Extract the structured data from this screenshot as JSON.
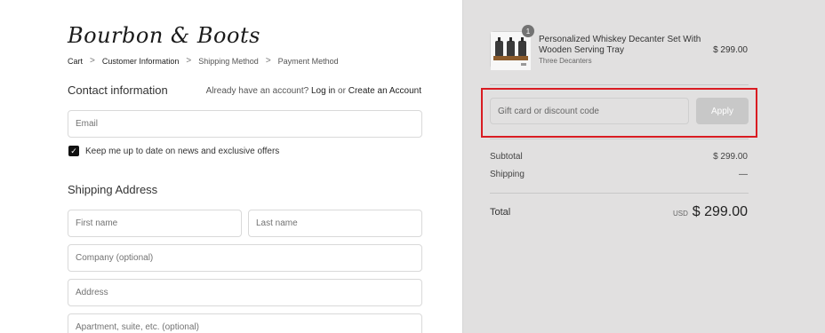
{
  "brand": {
    "logo_text": "Bourbon & Boots"
  },
  "breadcrumb": {
    "items": [
      "Cart",
      "Customer Information",
      "Shipping Method",
      "Payment Method"
    ],
    "separator": ">"
  },
  "contact": {
    "title": "Contact information",
    "account_prompt": "Already have an account?",
    "login_link": "Log in",
    "or_text": "or",
    "create_link": "Create an Account",
    "email_placeholder": "Email",
    "newsletter_label": "Keep me up to date on news and exclusive offers",
    "newsletter_checked": true
  },
  "shipping": {
    "title": "Shipping Address",
    "first_name_placeholder": "First name",
    "last_name_placeholder": "Last name",
    "company_placeholder": "Company (optional)",
    "address_placeholder": "Address",
    "apartment_placeholder": "Apartment, suite, etc. (optional)"
  },
  "order": {
    "product": {
      "name": "Personalized Whiskey Decanter Set With Wooden Serving Tray",
      "variant": "Three Decanters",
      "price": "$ 299.00",
      "quantity": "1"
    },
    "discount": {
      "placeholder": "Gift card or discount code",
      "apply_label": "Apply"
    },
    "subtotal_label": "Subtotal",
    "subtotal_value": "$ 299.00",
    "shipping_label": "Shipping",
    "shipping_value": "—",
    "total_label": "Total",
    "total_currency": "USD",
    "total_value": "$ 299.00"
  },
  "colors": {
    "sidebar_bg": "#e1e0e0",
    "highlight": "#d91c22",
    "apply_button": "#c8c8c8"
  }
}
